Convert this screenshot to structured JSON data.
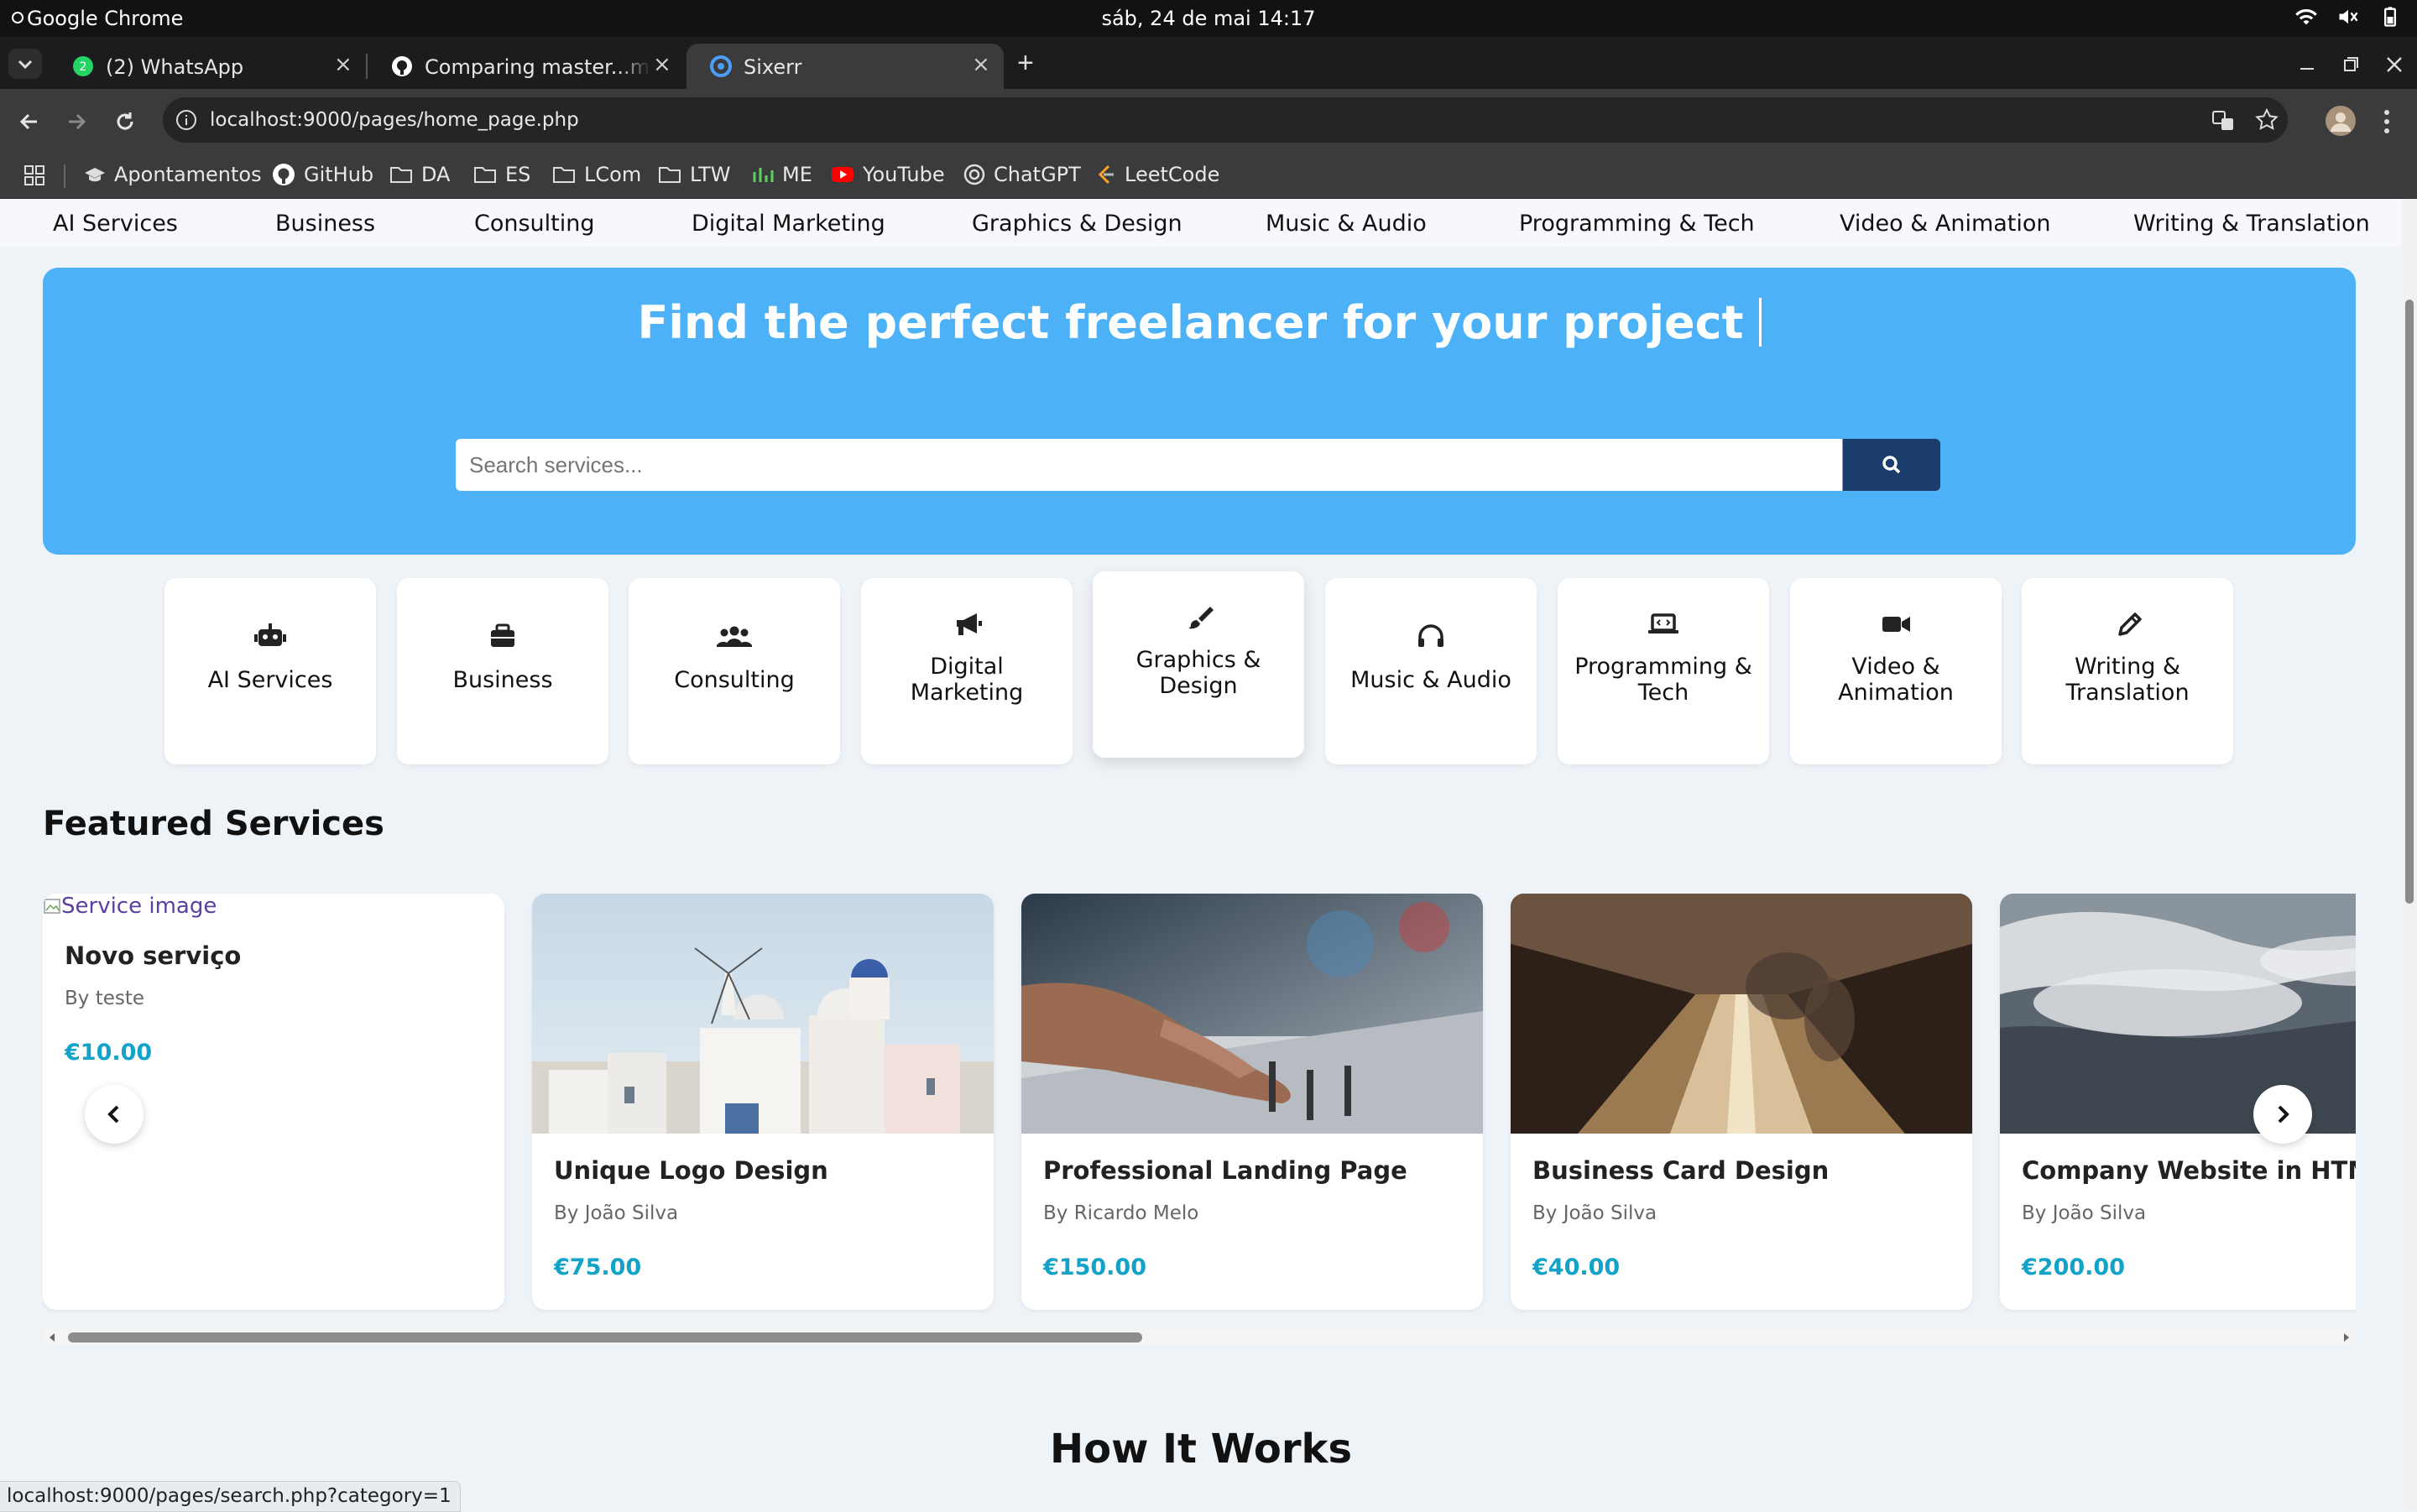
{
  "os": {
    "app_name": "Google Chrome",
    "clock": "sáb, 24 de mai  14:17"
  },
  "tabs": [
    {
      "title": "(2) WhatsApp",
      "badge": "2",
      "active": false
    },
    {
      "title": "Comparing master...med",
      "active": false
    },
    {
      "title": "Sixerr",
      "active": true
    }
  ],
  "toolbar": {
    "url": "localhost:9000/pages/home_page.php"
  },
  "bookmarks": [
    {
      "label": "Apontamentos",
      "icon": "graduation-cap-icon"
    },
    {
      "label": "GitHub",
      "icon": "github-icon"
    },
    {
      "label": "DA",
      "icon": "folder-icon"
    },
    {
      "label": "ES",
      "icon": "folder-icon"
    },
    {
      "label": "LCom",
      "icon": "folder-icon"
    },
    {
      "label": "LTW",
      "icon": "folder-icon"
    },
    {
      "label": "ME",
      "icon": "chart-icon"
    },
    {
      "label": "YouTube",
      "icon": "youtube-icon"
    },
    {
      "label": "ChatGPT",
      "icon": "chatgpt-icon"
    },
    {
      "label": "LeetCode",
      "icon": "leetcode-icon"
    }
  ],
  "nav": {
    "categories": [
      "AI Services",
      "Business",
      "Consulting",
      "Digital Marketing",
      "Graphics & Design",
      "Music & Audio",
      "Programming & Tech",
      "Video & Animation",
      "Writing & Translation"
    ]
  },
  "hero": {
    "title": "Find the perfect freelancer for your project",
    "search_placeholder": "Search services...",
    "accent": "#4db1f7",
    "button_color": "#1a3d6b"
  },
  "category_cards": [
    {
      "line1": "AI Services",
      "line2": "",
      "icon": "robot-icon"
    },
    {
      "line1": "Business",
      "line2": "",
      "icon": "briefcase-icon"
    },
    {
      "line1": "Consulting",
      "line2": "",
      "icon": "users-icon"
    },
    {
      "line1": "Digital",
      "line2": "Marketing",
      "icon": "megaphone-icon"
    },
    {
      "line1": "Graphics &",
      "line2": "Design",
      "icon": "paintbrush-icon"
    },
    {
      "line1": "Music & Audio",
      "line2": "",
      "icon": "headphones-icon"
    },
    {
      "line1": "Programming &",
      "line2": "Tech",
      "icon": "laptop-code-icon"
    },
    {
      "line1": "Video &",
      "line2": "Animation",
      "icon": "video-camera-icon"
    },
    {
      "line1": "Writing &",
      "line2": "Translation",
      "icon": "pencil-icon"
    }
  ],
  "featured": {
    "title": "Featured Services",
    "services": [
      {
        "image_alt": "Service image",
        "name": "Novo serviço",
        "by": "By teste",
        "price": "€10.00"
      },
      {
        "name": "Unique Logo Design",
        "by": "By João Silva",
        "price": "€75.00"
      },
      {
        "name": "Professional Landing Page",
        "by": "By Ricardo Melo",
        "price": "€150.00"
      },
      {
        "name": "Business Card Design",
        "by": "By João Silva",
        "price": "€40.00"
      },
      {
        "name": "Company Website in HTML/CSS",
        "by": "By João Silva",
        "price": "€200.00"
      }
    ],
    "price_color": "#13a3c9"
  },
  "how_it_works": {
    "title": "How It Works"
  },
  "status_bar": {
    "url": "localhost:9000/pages/search.php?category=1"
  }
}
